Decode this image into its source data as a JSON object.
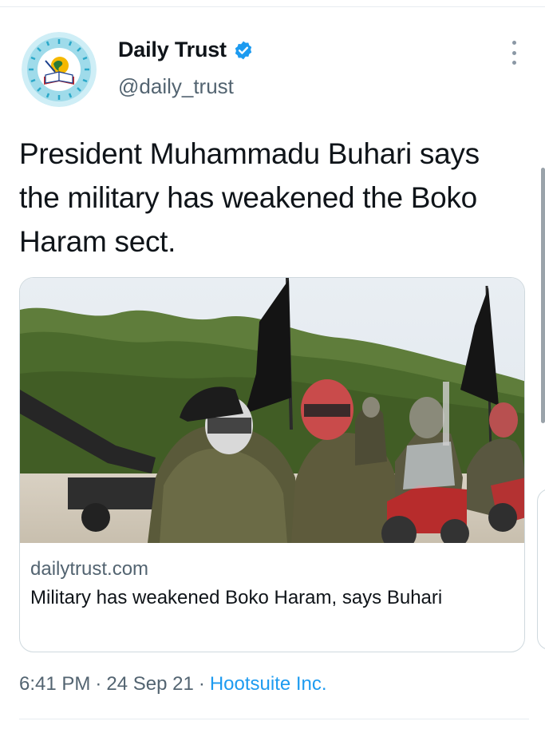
{
  "author": {
    "display_name": "Daily Trust",
    "handle": "@daily_trust",
    "verified": true,
    "avatar_icon": "daily-trust-logo-icon"
  },
  "tweet": {
    "text": "President Muhammadu Buhari says the military has weakened the Boko Haram sect."
  },
  "link_card": {
    "domain": "dailytrust.com",
    "title": "Military has weakened Boko Haram, says Buhari",
    "image_description": "photo-of-armed-men-on-motorcycles"
  },
  "meta": {
    "time": "6:41 PM",
    "separator": "·",
    "date": "24 Sep 21",
    "source": "Hootsuite Inc."
  },
  "colors": {
    "text_primary": "#0f1419",
    "text_secondary": "#536471",
    "link_blue": "#1d9bf0",
    "border": "#cfd9de"
  }
}
